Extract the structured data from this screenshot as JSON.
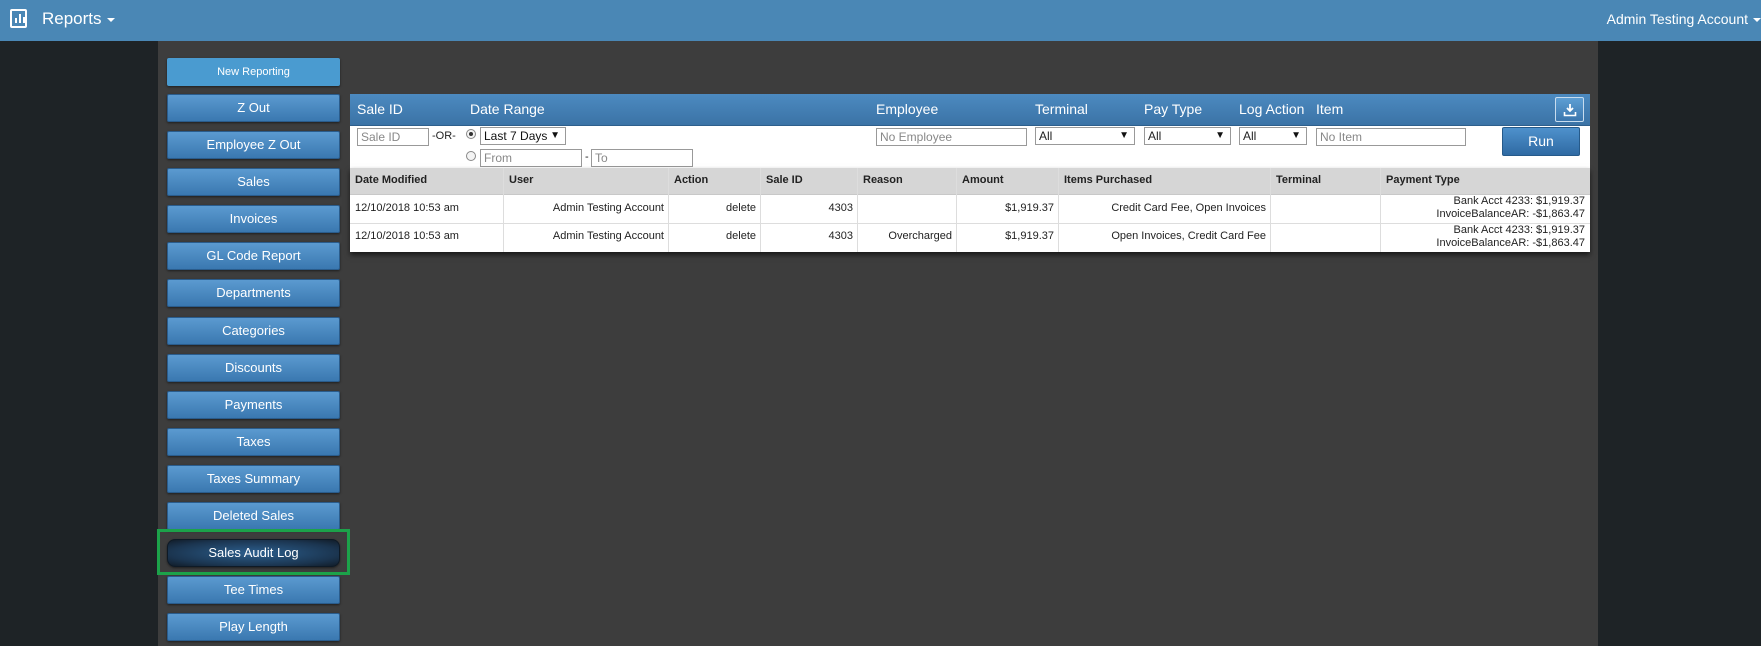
{
  "topbar": {
    "title": "Reports",
    "account": "Admin Testing Account"
  },
  "sidebar": {
    "new_reporting": "New Reporting",
    "items": [
      "Z Out",
      "Employee Z Out",
      "Sales",
      "Invoices",
      "GL Code Report",
      "Departments",
      "Categories",
      "Discounts",
      "Payments",
      "Taxes",
      "Taxes Summary",
      "Deleted Sales",
      "Sales Audit Log",
      "Tee Times",
      "Play Length"
    ],
    "active": "Sales Audit Log"
  },
  "filters": {
    "labels": {
      "sale_id": "Sale ID",
      "date_range": "Date Range",
      "employee": "Employee",
      "terminal": "Terminal",
      "pay_type": "Pay Type",
      "log_action": "Log Action",
      "item": "Item"
    },
    "sale_id_placeholder": "Sale ID",
    "or_text": "-OR-",
    "date_range_value": "Last 7 Days",
    "from_placeholder": "From",
    "dash": "-",
    "to_placeholder": "To",
    "employee_placeholder": "No Employee",
    "terminal_value": "All",
    "pay_type_value": "All",
    "log_action_value": "All",
    "item_placeholder": "No Item",
    "run_label": "Run"
  },
  "table": {
    "columns": [
      "Date Modified",
      "User",
      "Action",
      "Sale ID",
      "Reason",
      "Amount",
      "Items Purchased",
      "Terminal",
      "Payment Type"
    ],
    "rows": [
      {
        "date": "12/10/2018 10:53 am",
        "user": "Admin Testing Account",
        "action": "delete",
        "sale_id": "4303",
        "reason": "",
        "amount": "$1,919.37",
        "items": "Credit Card Fee, Open Invoices",
        "terminal": "",
        "payment_line1": "Bank Acct 4233: $1,919.37",
        "payment_line2": "InvoiceBalanceAR: -$1,863.47"
      },
      {
        "date": "12/10/2018 10:53 am",
        "user": "Admin Testing Account",
        "action": "delete",
        "sale_id": "4303",
        "reason": "Overcharged",
        "amount": "$1,919.37",
        "items": "Open Invoices, Credit Card Fee",
        "terminal": "",
        "payment_line1": "Bank Acct 4233: $1,919.37",
        "payment_line2": "InvoiceBalanceAR: -$1,863.47"
      }
    ]
  }
}
